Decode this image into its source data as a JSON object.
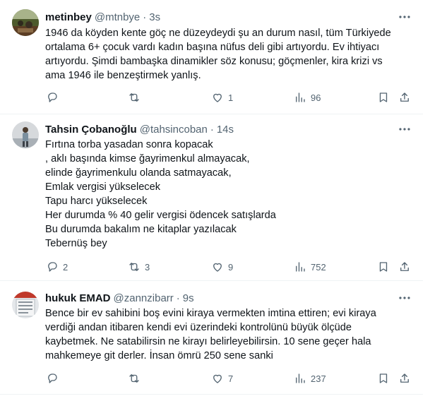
{
  "tweets": [
    {
      "name": "metinbey",
      "handle": "@mtnbye",
      "separator": "·",
      "time": "3s",
      "text": "1946 da  köyden kente göç ne düzeydeydi şu an durum nasıl, tüm Türkiyede\nortalama 6+ çocuk vardı kadın başına nüfus deli gibi artıyordu. Ev ihtiyacı\nartıyordu. Şimdi bambaşka dinamikler söz konusu; göçmenler, kira krizi vs\nama 1946 ile benzeştirmek yanlış.",
      "replies": "",
      "retweets": "",
      "likes": "1",
      "views": "96"
    },
    {
      "name": "Tahsin Çobanoğlu",
      "handle": "@tahsincoban",
      "separator": "·",
      "time": "14s",
      "text": "Fırtına torba yasadan sonra kopacak\n, aklı başında kimse ğayrimenkul almayacak,\nelinde ğayrimenkulu olanda satmayacak,\nEmlak vergisi yükselecek\nTapu harcı yükselecek\nHer durumda % 40 gelir vergisi ödencek satışlarda\nBu durumda bakalım ne kitaplar yazılacak\nTebernüş bey",
      "replies": "2",
      "retweets": "3",
      "likes": "9",
      "views": "752"
    },
    {
      "name": "hukuk EMAD",
      "handle": "@zannzibarr",
      "separator": "·",
      "time": "9s",
      "text": "Bence bir ev sahibini boş evini kiraya vermekten imtina ettiren; evi kiraya\nverdiği andan itibaren kendi evi üzerindeki kontrolünü büyük ölçüde\nkaybetmek. Ne satabilirsin ne kirayı belirleyebilirsin. 10 sene geçer hala\nmahkemeye git derler. İnsan ömrü 250 sene sanki",
      "replies": "",
      "retweets": "",
      "likes": "7",
      "views": "237"
    }
  ],
  "icons": {
    "more": "more-horizontal-icon",
    "reply": "reply-icon",
    "retweet": "retweet-icon",
    "like": "heart-icon",
    "views": "views-chart-icon",
    "bookmark": "bookmark-icon",
    "share": "share-icon"
  },
  "colors": {
    "text_primary": "#0f1419",
    "text_secondary": "#536471",
    "divider": "#eff3f4",
    "background": "#ffffff"
  }
}
